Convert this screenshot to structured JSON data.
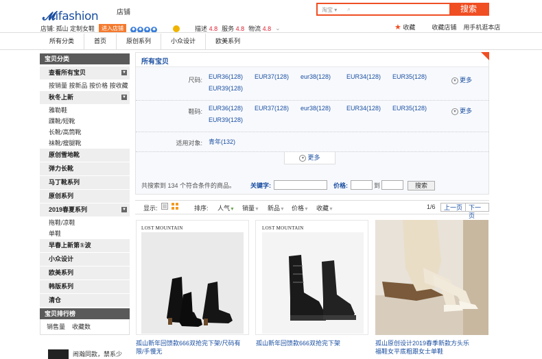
{
  "header": {
    "logo_text": "ifashion",
    "shop_nav_label": "店铺",
    "search_scope": "淘宝",
    "search_button": "搜索",
    "shop_line_prefix": "店铺:",
    "shop_name": "孤山 定制女鞋",
    "enter_shop": "进入店铺",
    "ratings": [
      {
        "label": "描述",
        "value": "4.8"
      },
      {
        "label": "服务",
        "value": "4.8"
      },
      {
        "label": "物流",
        "value": "4.8"
      }
    ],
    "fav_label": "收藏",
    "fav_shop": "收藏店铺",
    "mobile_link": "用手机逛本店"
  },
  "nav": [
    "所有分类",
    "首页",
    "原创系列",
    "小众设计",
    "欧美系列"
  ],
  "sidebar": {
    "title": "宝贝分类",
    "groups": [
      {
        "label": "查看所有宝贝",
        "toggle": true,
        "subs": [
          "按销量",
          "按新品",
          "按价格",
          "按收藏"
        ]
      },
      {
        "label": "秋冬上新",
        "toggle": true,
        "subs": [
          "雅勒鞋",
          "踝靴/短靴",
          "长靴/高筒靴",
          "袜靴/瘦腿靴"
        ]
      },
      {
        "label": "原创雪地靴",
        "toggle": false,
        "subs": []
      },
      {
        "label": "弹力长靴",
        "toggle": false,
        "subs": []
      },
      {
        "label": "马丁靴系列",
        "toggle": false,
        "subs": []
      },
      {
        "label": "原创系列",
        "toggle": false,
        "subs": []
      },
      {
        "label": "2019春夏系列",
        "toggle": true,
        "subs": [
          "拖鞋/凉鞋",
          "单鞋"
        ]
      },
      {
        "label": "早春上新第①波",
        "toggle": false,
        "subs": []
      },
      {
        "label": "小众设计",
        "toggle": false,
        "subs": []
      },
      {
        "label": "欧美系列",
        "toggle": false,
        "subs": []
      },
      {
        "label": "韩版系列",
        "toggle": false,
        "subs": []
      },
      {
        "label": "清仓",
        "toggle": false,
        "subs": []
      }
    ],
    "rank_title": "宝贝排行榜",
    "rank_tabs": [
      "销售量",
      "收藏数"
    ],
    "rank_item": "闹瀚同款，禁系少"
  },
  "filter": {
    "title": "所有宝贝",
    "rows": [
      {
        "label": "尺码:",
        "values": [
          "EUR36(128)",
          "EUR37(128)",
          "eur38(128)",
          "EUR34(128)",
          "EUR35(128)",
          "EUR39(128)"
        ],
        "more": "更多"
      },
      {
        "label": "鞋码:",
        "values": [
          "EUR36(128)",
          "EUR37(128)",
          "eur38(128)",
          "EUR34(128)",
          "EUR35(128)",
          "EUR39(128)"
        ],
        "more": "更多"
      },
      {
        "label": "适用对象:",
        "values": [
          "青年(132)"
        ],
        "more": ""
      }
    ],
    "more_toggle": "更多",
    "result_text": "共搜索到 134 个符合条件的商品。",
    "keyword_label": "关键字:",
    "price_label": "价格:",
    "to_label": "到",
    "search_btn": "搜索"
  },
  "sortbar": {
    "display_label": "显示:",
    "sort_label": "排序:",
    "options": [
      "人气",
      "销量",
      "新品",
      "价格",
      "收藏"
    ],
    "page": "1/6",
    "prev": "上一页",
    "next": "下一页"
  },
  "products": [
    {
      "brand": "LOST MOUNTAIN",
      "title": "孤山新年回馈款666双抢完下架/尺码有限/手慢无"
    },
    {
      "brand": "LOST MOUNTAIN",
      "title": "孤山新年回馈款666双抢完下架"
    },
    {
      "brand": "",
      "title": "孤山原创设计2019春季新款方头乐福鞋女平底粗跟女士单鞋"
    }
  ]
}
